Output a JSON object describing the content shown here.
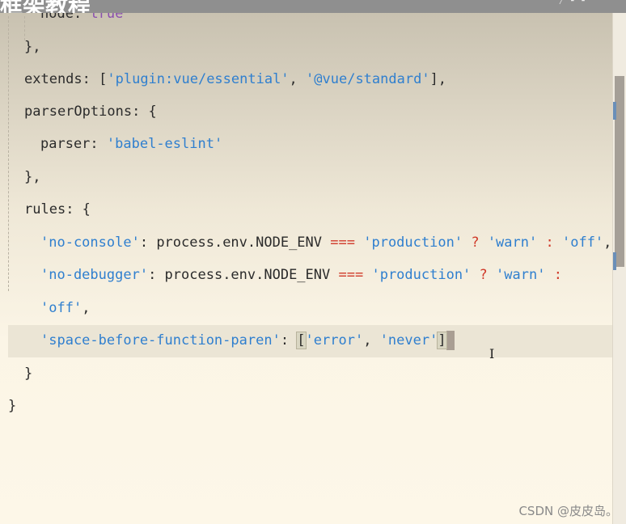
{
  "overlay": {
    "title": "框架教程"
  },
  "code": {
    "l0": {
      "key": "node",
      "val": "true"
    },
    "l1": "},",
    "l2": {
      "key": "extends",
      "a": "'plugin:vue/essential'",
      "b": "'@vue/standard'"
    },
    "l3": {
      "key": "parserOptions"
    },
    "l4": {
      "key": "parser",
      "val": "'babel-eslint'"
    },
    "l5": "},",
    "l6": {
      "key": "rules"
    },
    "l7": {
      "key": "'no-console'",
      "expr": "process.env.NODE_ENV",
      "op": "===",
      "cmp": "'production'",
      "t": "'warn'",
      "f": "'off'"
    },
    "l8": {
      "key": "'no-debugger'",
      "expr": "process.env.NODE_ENV",
      "op": "===",
      "cmp": "'production'",
      "t": "'warn'"
    },
    "l9": {
      "f": "'off'"
    },
    "l10": {
      "key": "'space-before-function-paren'",
      "a": "'error'",
      "b": "'never'"
    },
    "l11": "}",
    "l12": "}"
  },
  "watermark": "CSDN @皮皮岛。"
}
